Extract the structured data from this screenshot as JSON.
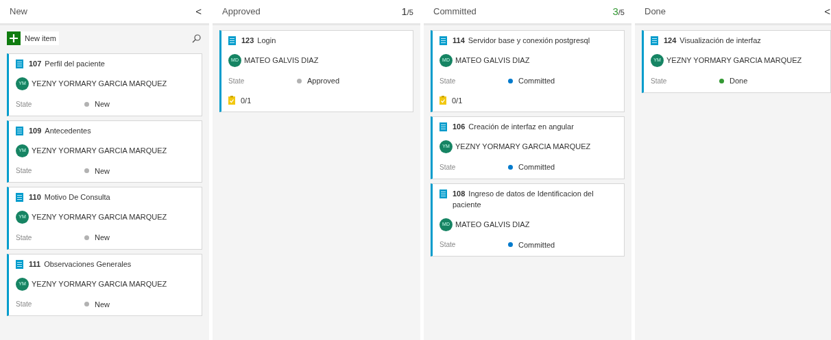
{
  "columns": [
    {
      "name": "New",
      "collapse": "<",
      "new_item": {
        "label": "New item"
      },
      "cards": [
        {
          "id": "107",
          "title": "Perfil del paciente",
          "assignee": {
            "initials": "YM",
            "name": "YEZNY YORMARY GARCIA MARQUEZ"
          },
          "state_label": "State",
          "state": {
            "text": "New",
            "color": "#b2b2b2"
          }
        },
        {
          "id": "109",
          "title": "Antecedentes",
          "assignee": {
            "initials": "YM",
            "name": "YEZNY YORMARY GARCIA MARQUEZ"
          },
          "state_label": "State",
          "state": {
            "text": "New",
            "color": "#b2b2b2"
          }
        },
        {
          "id": "110",
          "title": "Motivo De Consulta",
          "assignee": {
            "initials": "YM",
            "name": "YEZNY YORMARY GARCIA MARQUEZ"
          },
          "state_label": "State",
          "state": {
            "text": "New",
            "color": "#b2b2b2"
          }
        },
        {
          "id": "111",
          "title": "Observaciones Generales",
          "assignee": {
            "initials": "YM",
            "name": "YEZNY YORMARY GARCIA MARQUEZ"
          },
          "state_label": "State",
          "state": {
            "text": "New",
            "color": "#b2b2b2"
          }
        }
      ]
    },
    {
      "name": "Approved",
      "count": "1",
      "limit": "/5",
      "color": "#333333",
      "cards": [
        {
          "id": "123",
          "title": "Login",
          "assignee": {
            "initials": "MD",
            "name": "MATEO GALVIS DIAZ"
          },
          "state_label": "State",
          "state": {
            "text": "Approved",
            "color": "#b2b2b2"
          },
          "tasks": "0/1"
        }
      ]
    },
    {
      "name": "Committed",
      "count": "3",
      "limit": "/5",
      "color": "#339933",
      "cards": [
        {
          "id": "114",
          "title": "Servidor base y conexión postgresql",
          "assignee": {
            "initials": "MD",
            "name": "MATEO GALVIS DIAZ"
          },
          "state_label": "State",
          "state": {
            "text": "Committed",
            "color": "#007acc"
          },
          "tasks": "0/1"
        },
        {
          "id": "106",
          "title": "Creación de interfaz en angular",
          "assignee": {
            "initials": "YM",
            "name": "YEZNY YORMARY GARCIA MARQUEZ"
          },
          "state_label": "State",
          "state": {
            "text": "Committed",
            "color": "#007acc"
          }
        },
        {
          "id": "108",
          "title": "Ingreso de datos de Identificacion del paciente",
          "assignee": {
            "initials": "MD",
            "name": "MATEO GALVIS DIAZ"
          },
          "state_label": "State",
          "state": {
            "text": "Committed",
            "color": "#007acc"
          }
        }
      ]
    },
    {
      "name": "Done",
      "collapse": "<",
      "cards": [
        {
          "id": "124",
          "title": "Visualización de interfaz",
          "assignee": {
            "initials": "YM",
            "name": "YEZNY YORMARY GARCIA MARQUEZ"
          },
          "state_label": "State",
          "state": {
            "text": "Done",
            "color": "#339933"
          }
        }
      ]
    }
  ]
}
